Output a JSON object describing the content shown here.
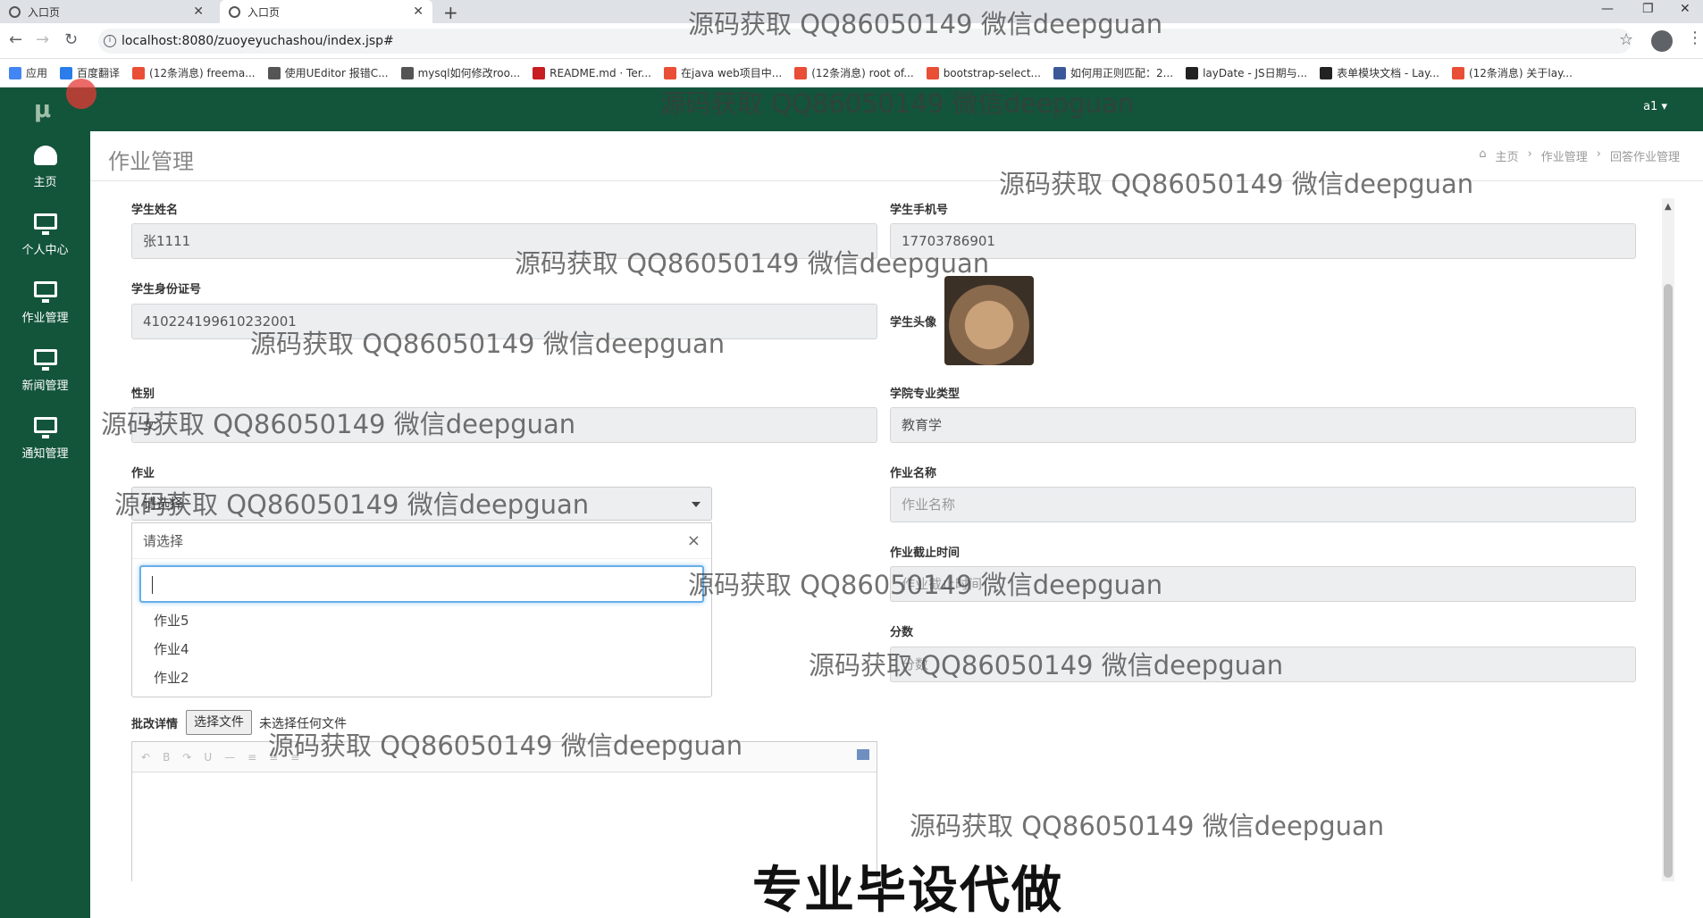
{
  "browser": {
    "tabs": [
      {
        "title": "入口页",
        "active": false
      },
      {
        "title": "入口页",
        "active": true
      }
    ],
    "url": "localhost:8080/zuoyeyuchashou/index.jsp#",
    "bookmarks": [
      {
        "label": "应用",
        "color": "#4285f4"
      },
      {
        "label": "百度翻译",
        "color": "#2b7de9"
      },
      {
        "label": "(12条消息) freema...",
        "color": "#e94e36"
      },
      {
        "label": "使用UEditor 报错C...",
        "color": "#555555"
      },
      {
        "label": "mysql如何修改roo...",
        "color": "#555555"
      },
      {
        "label": "README.md · Ter...",
        "color": "#c71d23"
      },
      {
        "label": "在java web项目中...",
        "color": "#e94e36"
      },
      {
        "label": "(12条消息) root of...",
        "color": "#e94e36"
      },
      {
        "label": "bootstrap-select...",
        "color": "#e94e36"
      },
      {
        "label": "如何用正则匹配：2...",
        "color": "#3b5998"
      },
      {
        "label": "layDate - JS日期与...",
        "color": "#222222"
      },
      {
        "label": "表单模块文档 - Lay...",
        "color": "#222222"
      },
      {
        "label": "(12条消息) 关于lay...",
        "color": "#e94e36"
      }
    ]
  },
  "app": {
    "logo": "μ",
    "user": "a1 ▾",
    "sidebar": [
      {
        "label": "主页",
        "icon": "dashboard-icon"
      },
      {
        "label": "个人中心",
        "icon": "monitor-icon"
      },
      {
        "label": "作业管理",
        "icon": "monitor-icon"
      },
      {
        "label": "新闻管理",
        "icon": "monitor-icon"
      },
      {
        "label": "通知管理",
        "icon": "monitor-icon"
      }
    ],
    "page_title": "作业管理",
    "breadcrumb": [
      "主页",
      "作业管理",
      "回答作业管理"
    ]
  },
  "form": {
    "student_name": {
      "label": "学生姓名",
      "value": "张1111"
    },
    "student_phone": {
      "label": "学生手机号",
      "value": "17703786901"
    },
    "student_id": {
      "label": "学生身份证号",
      "value": "410224199610232001"
    },
    "student_avatar": {
      "label": "学生头像"
    },
    "gender": {
      "label": "性别",
      "value": "女"
    },
    "major": {
      "label": "学院专业类型",
      "value": "教育学"
    },
    "homework": {
      "label": "作业",
      "selected": "请选择",
      "dropdown_header": "请选择",
      "options": [
        "作业5",
        "作业4",
        "作业2"
      ]
    },
    "homework_name": {
      "label": "作业名称",
      "placeholder": "作业名称"
    },
    "deadline": {
      "label": "作业截止时间",
      "placeholder": "作业截止时间"
    },
    "score": {
      "label": "分数",
      "placeholder": "分数"
    },
    "review_detail": {
      "label": "批改详情",
      "file_button": "选择文件",
      "file_status": "未选择任何文件"
    }
  },
  "watermarks": {
    "text": "源码获取 QQ86050149 微信deepguan",
    "banner": "专业毕设代做"
  }
}
